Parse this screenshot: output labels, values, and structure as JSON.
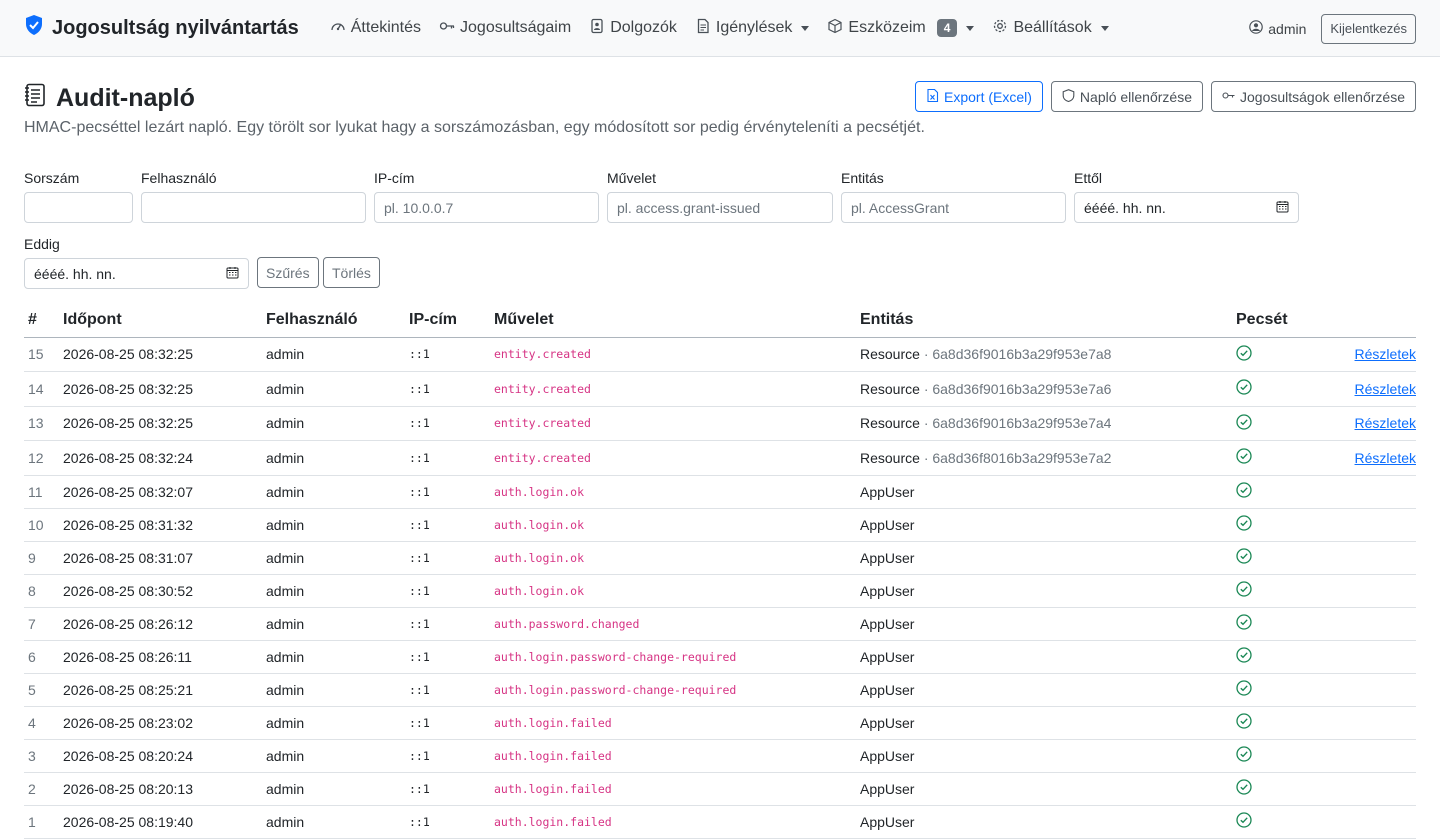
{
  "brand": "Jogosultság nyilvántartás",
  "nav": {
    "overview": "Áttekintés",
    "my_rights": "Jogosultságaim",
    "employees": "Dolgozók",
    "requests": "Igénylések",
    "my_tools": "Eszközeim",
    "my_tools_badge": "4",
    "settings": "Beállítások"
  },
  "user": {
    "name": "admin",
    "logout": "Kijelentkezés"
  },
  "page": {
    "title": "Audit-napló",
    "subtitle": "HMAC-pecséttel lezárt napló. Egy törölt sor lyukat hagy a sorszámozásban, egy módosított sor pedig érvényteleníti a pecsétjét.",
    "export": "Export (Excel)",
    "verify_log": "Napló ellenőrzése",
    "verify_rights": "Jogosultságok ellenőrzése"
  },
  "filters": {
    "seq_label": "Sorszám",
    "user_label": "Felhasználó",
    "ip_label": "IP-cím",
    "ip_placeholder": "pl. 10.0.0.7",
    "op_label": "Művelet",
    "op_placeholder": "pl. access.grant-issued",
    "entity_label": "Entitás",
    "entity_placeholder": "pl. AccessGrant",
    "from_label": "Ettől",
    "from_placeholder": "éééé. hh. nn.",
    "to_label": "Eddig",
    "to_placeholder": "éééé. hh. nn.",
    "filter_btn": "Szűrés",
    "clear_btn": "Törlés"
  },
  "table": {
    "headers": [
      "#",
      "Időpont",
      "Felhasználó",
      "IP-cím",
      "Művelet",
      "Entitás",
      "Pecsét"
    ],
    "details_label": "Részletek",
    "rows": [
      {
        "n": "15",
        "time": "2026-08-25 08:32:25",
        "user": "admin",
        "ip": "::1",
        "op": "entity.created",
        "entity": "Resource",
        "eid": "· 6a8d36f9016b3a29f953e7a8",
        "details": true
      },
      {
        "n": "14",
        "time": "2026-08-25 08:32:25",
        "user": "admin",
        "ip": "::1",
        "op": "entity.created",
        "entity": "Resource",
        "eid": "· 6a8d36f9016b3a29f953e7a6",
        "details": true
      },
      {
        "n": "13",
        "time": "2026-08-25 08:32:25",
        "user": "admin",
        "ip": "::1",
        "op": "entity.created",
        "entity": "Resource",
        "eid": "· 6a8d36f9016b3a29f953e7a4",
        "details": true
      },
      {
        "n": "12",
        "time": "2026-08-25 08:32:24",
        "user": "admin",
        "ip": "::1",
        "op": "entity.created",
        "entity": "Resource",
        "eid": "· 6a8d36f8016b3a29f953e7a2",
        "details": true
      },
      {
        "n": "11",
        "time": "2026-08-25 08:32:07",
        "user": "admin",
        "ip": "::1",
        "op": "auth.login.ok",
        "entity": "AppUser",
        "eid": "",
        "details": false
      },
      {
        "n": "10",
        "time": "2026-08-25 08:31:32",
        "user": "admin",
        "ip": "::1",
        "op": "auth.login.ok",
        "entity": "AppUser",
        "eid": "",
        "details": false
      },
      {
        "n": "9",
        "time": "2026-08-25 08:31:07",
        "user": "admin",
        "ip": "::1",
        "op": "auth.login.ok",
        "entity": "AppUser",
        "eid": "",
        "details": false
      },
      {
        "n": "8",
        "time": "2026-08-25 08:30:52",
        "user": "admin",
        "ip": "::1",
        "op": "auth.login.ok",
        "entity": "AppUser",
        "eid": "",
        "details": false
      },
      {
        "n": "7",
        "time": "2026-08-25 08:26:12",
        "user": "admin",
        "ip": "::1",
        "op": "auth.password.changed",
        "entity": "AppUser",
        "eid": "",
        "details": false
      },
      {
        "n": "6",
        "time": "2026-08-25 08:26:11",
        "user": "admin",
        "ip": "::1",
        "op": "auth.login.password-change-required",
        "entity": "AppUser",
        "eid": "",
        "details": false
      },
      {
        "n": "5",
        "time": "2026-08-25 08:25:21",
        "user": "admin",
        "ip": "::1",
        "op": "auth.login.password-change-required",
        "entity": "AppUser",
        "eid": "",
        "details": false
      },
      {
        "n": "4",
        "time": "2026-08-25 08:23:02",
        "user": "admin",
        "ip": "::1",
        "op": "auth.login.failed",
        "entity": "AppUser",
        "eid": "",
        "details": false
      },
      {
        "n": "3",
        "time": "2026-08-25 08:20:24",
        "user": "admin",
        "ip": "::1",
        "op": "auth.login.failed",
        "entity": "AppUser",
        "eid": "",
        "details": false
      },
      {
        "n": "2",
        "time": "2026-08-25 08:20:13",
        "user": "admin",
        "ip": "::1",
        "op": "auth.login.failed",
        "entity": "AppUser",
        "eid": "",
        "details": false
      },
      {
        "n": "1",
        "time": "2026-08-25 08:19:40",
        "user": "admin",
        "ip": "::1",
        "op": "auth.login.failed",
        "entity": "AppUser",
        "eid": "",
        "details": false
      }
    ]
  },
  "colors": {
    "seal_ok": "#198754",
    "op_text": "#d63384",
    "link": "#0d6efd",
    "brand_icon": "#0d6efd"
  }
}
